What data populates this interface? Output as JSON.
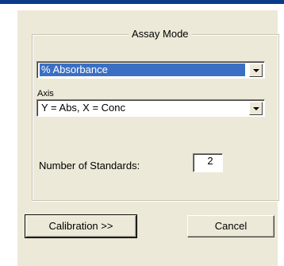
{
  "dialog": {
    "group_title": "Assay Mode",
    "mode_select": {
      "value": "% Absorbance"
    },
    "axis_label": "Axis",
    "axis_select": {
      "value": "Y = Abs, X = Conc"
    },
    "standards_label": "Number of Standards:",
    "standards_value": "2",
    "calibration_button": "Calibration  >>",
    "cancel_button": "Cancel"
  },
  "colors": {
    "title_bar": "#0a3b8a",
    "dialog_face": "#ece9d8",
    "selection": "#3a6fc4"
  }
}
